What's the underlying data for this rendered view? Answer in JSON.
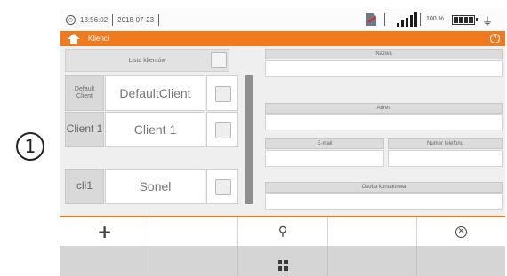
{
  "callout": "1",
  "status": {
    "time": "13:56:02",
    "date": "2018-07-23",
    "battery": "100 %",
    "icons": [
      "clock-icon",
      "sd-card-error-icon",
      "signal-icon",
      "battery-icon",
      "plug-icon"
    ]
  },
  "header": {
    "title": "Klienci",
    "icons": [
      "home-icon",
      "help-icon"
    ],
    "accent": "#f07a1e"
  },
  "list": {
    "header_label": "Lista klientów",
    "rows": [
      {
        "code": "Default Client",
        "name": "DefaultClient"
      },
      {
        "code": "Client 1",
        "name": "Client 1"
      },
      {
        "code": "cli1",
        "name": "Sonel"
      }
    ]
  },
  "details": {
    "name_label": "Nazwa",
    "address_label": "Adres",
    "email_label": "E-mail",
    "phone_label": "Numer telefonu",
    "contact_label": "Osoba kontaktowa"
  },
  "toolbar": {
    "icons": [
      "add-icon",
      "search-icon",
      "cancel-icon"
    ]
  },
  "nav": {
    "icons": [
      "menu-grid-icon"
    ]
  }
}
